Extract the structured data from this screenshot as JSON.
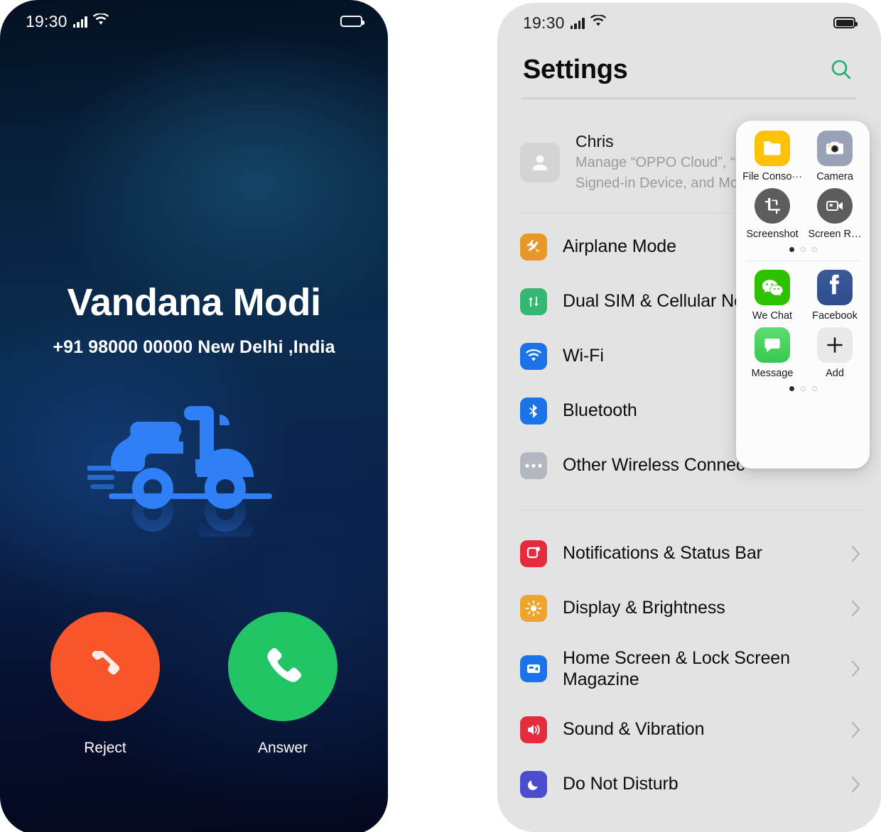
{
  "call_screen": {
    "status_bar": {
      "time": "19:30",
      "signal_icon": "cellular-signal-icon",
      "wifi_icon": "wifi-icon",
      "battery_icon": "battery-icon"
    },
    "caller_name": "Vandana Modi",
    "caller_number": "+91 98000 00000 New Delhi ,India",
    "illustration": "scooter-illustration",
    "reject": {
      "label": "Reject",
      "icon": "phone-hangup-icon",
      "color": "#f8562a"
    },
    "answer": {
      "label": "Answer",
      "icon": "phone-call-icon",
      "color": "#21c566"
    }
  },
  "settings_screen": {
    "status_bar": {
      "time": "19:30",
      "signal_icon": "cellular-signal-icon",
      "wifi_icon": "wifi-icon",
      "battery_icon": "battery-icon"
    },
    "title": "Settings",
    "search_icon": "search-icon",
    "search_color": "#18b26a",
    "profile": {
      "avatar_icon": "person-avatar-icon",
      "name": "Chris",
      "subtitle": "Manage “OPPO Cloud”, “Fin\nSigned-in Device, and More"
    },
    "group_one": [
      {
        "label": "Airplane Mode",
        "icon": "airplane-icon",
        "color": "#e8972a",
        "chevron": false
      },
      {
        "label": "Dual SIM  & Cellular Ne",
        "icon": "dual-sim-arrows-icon",
        "color": "#34b771",
        "chevron": false
      },
      {
        "label": "Wi-Fi",
        "icon": "wifi-icon",
        "color": "#1a74e8",
        "chevron": false
      },
      {
        "label": "Bluetooth",
        "icon": "bluetooth-icon",
        "color": "#1a74e8",
        "chevron": false
      },
      {
        "label": "Other Wireless Connec",
        "icon": "ellipsis-icon",
        "color": "#b3b7c0",
        "chevron": false
      }
    ],
    "group_two": [
      {
        "label": "Notifications & Status Bar",
        "icon": "notification-badge-icon",
        "color": "#e32d3f",
        "chevron": "›"
      },
      {
        "label": "Display & Brightness",
        "icon": "brightness-sun-icon",
        "color": "#eda52c",
        "chevron": "›"
      },
      {
        "label": "Home Screen & Lock Screen\nMagazine",
        "icon": "home-lock-screen-icon",
        "color": "#1a74e8",
        "chevron": "›"
      },
      {
        "label": "Sound & Vibration",
        "icon": "speaker-volume-icon",
        "color": "#e32d3f",
        "chevron": "›"
      },
      {
        "label": "Do Not Disturb",
        "icon": "moon-icon",
        "color": "#4c4bcf",
        "chevron": "›"
      }
    ]
  },
  "app_popup": {
    "page_one": {
      "row_a": [
        {
          "label": "File Conso···",
          "icon": "folder-icon",
          "color": "#fcc20a"
        },
        {
          "label": "Camera",
          "icon": "camera-icon",
          "color": "#9ba2b8"
        }
      ],
      "row_b": [
        {
          "label": "Screenshot",
          "icon": "screenshot-crop-icon",
          "color": "#5d5d5d"
        },
        {
          "label": "Screen R…",
          "icon": "screen-record-video-icon",
          "color": "#5d5d5d"
        }
      ],
      "dots": {
        "count": 3,
        "active": 1
      }
    },
    "page_two": {
      "row_a": [
        {
          "label": "We Chat",
          "icon": "wechat-icon",
          "color": "#2dc100"
        },
        {
          "label": "Facebook",
          "icon": "facebook-icon",
          "color": "#3b5998"
        }
      ],
      "row_b": [
        {
          "label": "Message",
          "icon": "message-bubble-icon",
          "color": "#4bd15f"
        },
        {
          "label": "Add",
          "icon": "plus-add-icon",
          "color": "#e9e9e9"
        }
      ],
      "dots": {
        "count": 3,
        "active": 1
      }
    }
  }
}
